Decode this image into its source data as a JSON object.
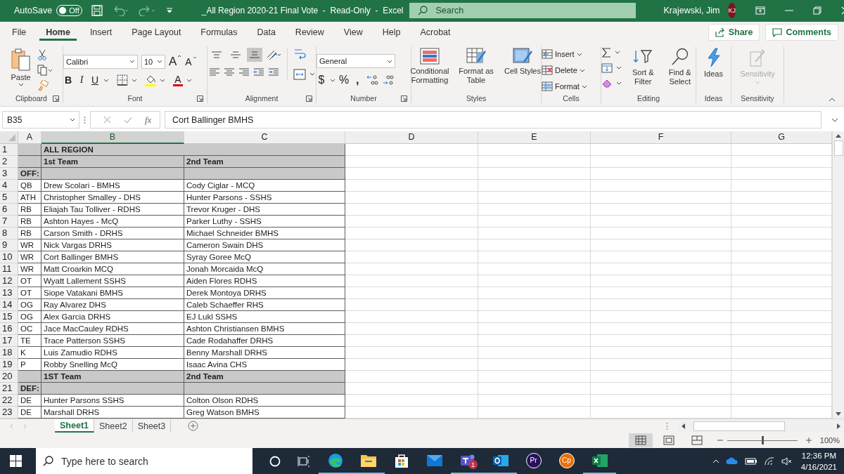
{
  "titlebar": {
    "autosave_label": "AutoSave",
    "autosave": {
      "on": false,
      "label": "Off"
    },
    "title": "_All Region 2020-21 Final Vote  -  Read-Only  -  Excel",
    "search_placeholder": "Search",
    "user": "Krajewski, Jim",
    "initials": "KJ"
  },
  "tabs": [
    {
      "label": "File",
      "selected": false
    },
    {
      "label": "Home",
      "selected": true
    },
    {
      "label": "Insert",
      "selected": false
    },
    {
      "label": "Page Layout",
      "selected": false
    },
    {
      "label": "Formulas",
      "selected": false
    },
    {
      "label": "Data",
      "selected": false
    },
    {
      "label": "Review",
      "selected": false
    },
    {
      "label": "View",
      "selected": false
    },
    {
      "label": "Help",
      "selected": false
    },
    {
      "label": "Acrobat",
      "selected": false
    }
  ],
  "share": "Share",
  "comments": "Comments",
  "ribbon": {
    "clipboard": {
      "paste": "Paste",
      "label": "Clipboard"
    },
    "font": {
      "name": "Calibri",
      "size": "10",
      "grow": "A",
      "shrink": "A",
      "styles": [
        {
          "kind": "bold",
          "label": "B"
        },
        {
          "kind": "italic",
          "label": "I"
        },
        {
          "kind": "underline",
          "label": "U"
        }
      ],
      "color_label": "A",
      "label": "Font"
    },
    "alignment": {
      "vertical": [
        {
          "kind": "top",
          "selected": false
        },
        {
          "kind": "middle",
          "selected": false
        },
        {
          "kind": "bottom",
          "selected": true
        }
      ],
      "label": "Alignment"
    },
    "number": {
      "format": "General",
      "currency": "$",
      "percent": "%",
      "comma": ",",
      "label": "Number"
    },
    "styles": {
      "buttons": [
        {
          "kind": "conditional",
          "label": "Conditional Formatting"
        },
        {
          "kind": "table",
          "label": "Format as Table"
        },
        {
          "kind": "cell",
          "label": "Cell Styles"
        }
      ],
      "label": "Styles"
    },
    "cells": {
      "buttons": [
        {
          "kind": "insert",
          "label": "Insert"
        },
        {
          "kind": "delete",
          "label": "Delete"
        },
        {
          "kind": "format",
          "label": "Format"
        }
      ],
      "label": "Cells"
    },
    "editing": {
      "buttons": [
        {
          "kind": "sort",
          "label": "Sort & Filter"
        },
        {
          "kind": "find",
          "label": "Find & Select"
        }
      ],
      "label": "Editing"
    },
    "ideas": {
      "button": "Ideas",
      "label": "Ideas"
    },
    "sensitivity": {
      "button": "Sensitivity",
      "disabled": true,
      "label": "Sensitivity"
    }
  },
  "formula_bar": {
    "name_box": "B35",
    "fx": "fx",
    "value": "Cort Ballinger BMHS"
  },
  "sheet": {
    "columns": [
      {
        "label": "A",
        "selected": false
      },
      {
        "label": "B",
        "selected": true
      },
      {
        "label": "C",
        "selected": false
      },
      {
        "label": "D",
        "selected": false
      },
      {
        "label": "E",
        "selected": false
      },
      {
        "label": "F",
        "selected": false
      },
      {
        "label": "G",
        "selected": false
      }
    ],
    "rows": [
      {
        "number": "1",
        "kind": "title",
        "b": "ALL REGION"
      },
      {
        "number": "2",
        "kind": "band",
        "b": "1st Team",
        "c": "2nd Team"
      },
      {
        "number": "3",
        "kind": "band",
        "a": "OFF:"
      },
      {
        "number": "4",
        "kind": "player",
        "a": "QB",
        "b": "Drew Scolari - BMHS",
        "c": "Cody Ciglar - MCQ"
      },
      {
        "number": "5",
        "kind": "player",
        "a": "ATH",
        "b": "Christopher Smalley - DHS",
        "c": "Hunter Parsons - SSHS"
      },
      {
        "number": "6",
        "kind": "player",
        "a": "RB",
        "b": "Eliajah Tau Tolliver - RDHS",
        "c": "Trevor Kruger - DHS"
      },
      {
        "number": "7",
        "kind": "player",
        "a": "RB",
        "b": "Ashton Hayes - McQ",
        "c": "Parker Luthy - SSHS"
      },
      {
        "number": "8",
        "kind": "player",
        "a": "RB",
        "b": "Carson Smith - DRHS",
        "c": "Michael Schneider BMHS"
      },
      {
        "number": "9",
        "kind": "player",
        "a": "WR",
        "b": "Nick Vargas DRHS",
        "c": "Cameron Swain DHS"
      },
      {
        "number": "10",
        "kind": "player",
        "a": "WR",
        "b": "Cort Ballinger BMHS",
        "c": "Syray Goree McQ"
      },
      {
        "number": "11",
        "kind": "player",
        "a": "WR",
        "b": "Matt Croarkin MCQ",
        "c": "Jonah Morcaida McQ"
      },
      {
        "number": "12",
        "kind": "player",
        "a": "OT",
        "b": "Wyatt Lallement SSHS",
        "c": "Aiden Flores RDHS"
      },
      {
        "number": "13",
        "kind": "player",
        "a": "OT",
        "b": "Siope Vatakani BMHS",
        "c": "Derek Montoya DRHS"
      },
      {
        "number": "14",
        "kind": "player",
        "a": "OG",
        "b": "Ray Alvarez DHS",
        "c": "Caleb Schaeffer RHS"
      },
      {
        "number": "15",
        "kind": "player",
        "a": "OG",
        "b": "Alex Garcia DRHS",
        "c": "EJ Lukl SSHS"
      },
      {
        "number": "16",
        "kind": "player",
        "a": "OC",
        "b": "Jace MacCauley RDHS",
        "c": "Ashton Christiansen BMHS"
      },
      {
        "number": "17",
        "kind": "player",
        "a": "TE",
        "b": "Trace Patterson SSHS",
        "c": "Cade Rodahaffer DRHS"
      },
      {
        "number": "18",
        "kind": "player",
        "a": "K",
        "b": "Luis Zamudio RDHS",
        "c": "Benny Marshall DRHS"
      },
      {
        "number": "19",
        "kind": "player",
        "a": "P",
        "b": "Robby Snelling McQ",
        "c": "Isaac Avina CHS"
      },
      {
        "number": "20",
        "kind": "band",
        "b": "1ST Team",
        "c": "2nd Team"
      },
      {
        "number": "21",
        "kind": "band",
        "a": "DEF:"
      },
      {
        "number": "22",
        "kind": "player",
        "a": "DE",
        "b": "Hunter Parsons SSHS",
        "c": "Colton Olson RDHS"
      },
      {
        "number": "23",
        "kind": "player",
        "a": "DE",
        "b": "Marshall DRHS",
        "c": "Greg Watson BMHS"
      }
    ]
  },
  "sheet_tabs": [
    {
      "label": "Sheet1",
      "selected": true
    },
    {
      "label": "Sheet2",
      "selected": false
    },
    {
      "label": "Sheet3",
      "selected": false
    }
  ],
  "status": {
    "views": [
      {
        "kind": "normal",
        "selected": true
      },
      {
        "kind": "layout",
        "selected": false
      },
      {
        "kind": "break",
        "selected": false
      }
    ],
    "zoom_slider": {
      "level": 0.5
    },
    "zoom": "100%"
  },
  "taskbar": {
    "search_placeholder": "Type here to search",
    "apps": [
      {
        "kind": "edge",
        "running": true
      },
      {
        "kind": "explorer",
        "running": true
      },
      {
        "kind": "store",
        "running": false
      },
      {
        "kind": "mail",
        "running": false
      },
      {
        "kind": "teams",
        "running": true,
        "badge": "1"
      },
      {
        "kind": "outlook",
        "running": true
      },
      {
        "kind": "premiere",
        "running": false,
        "label": "Pr"
      },
      {
        "kind": "captivate",
        "running": false,
        "label": "Cp"
      },
      {
        "kind": "excel",
        "running": true
      }
    ],
    "time": "12:36 PM",
    "date": "4/16/2021"
  }
}
